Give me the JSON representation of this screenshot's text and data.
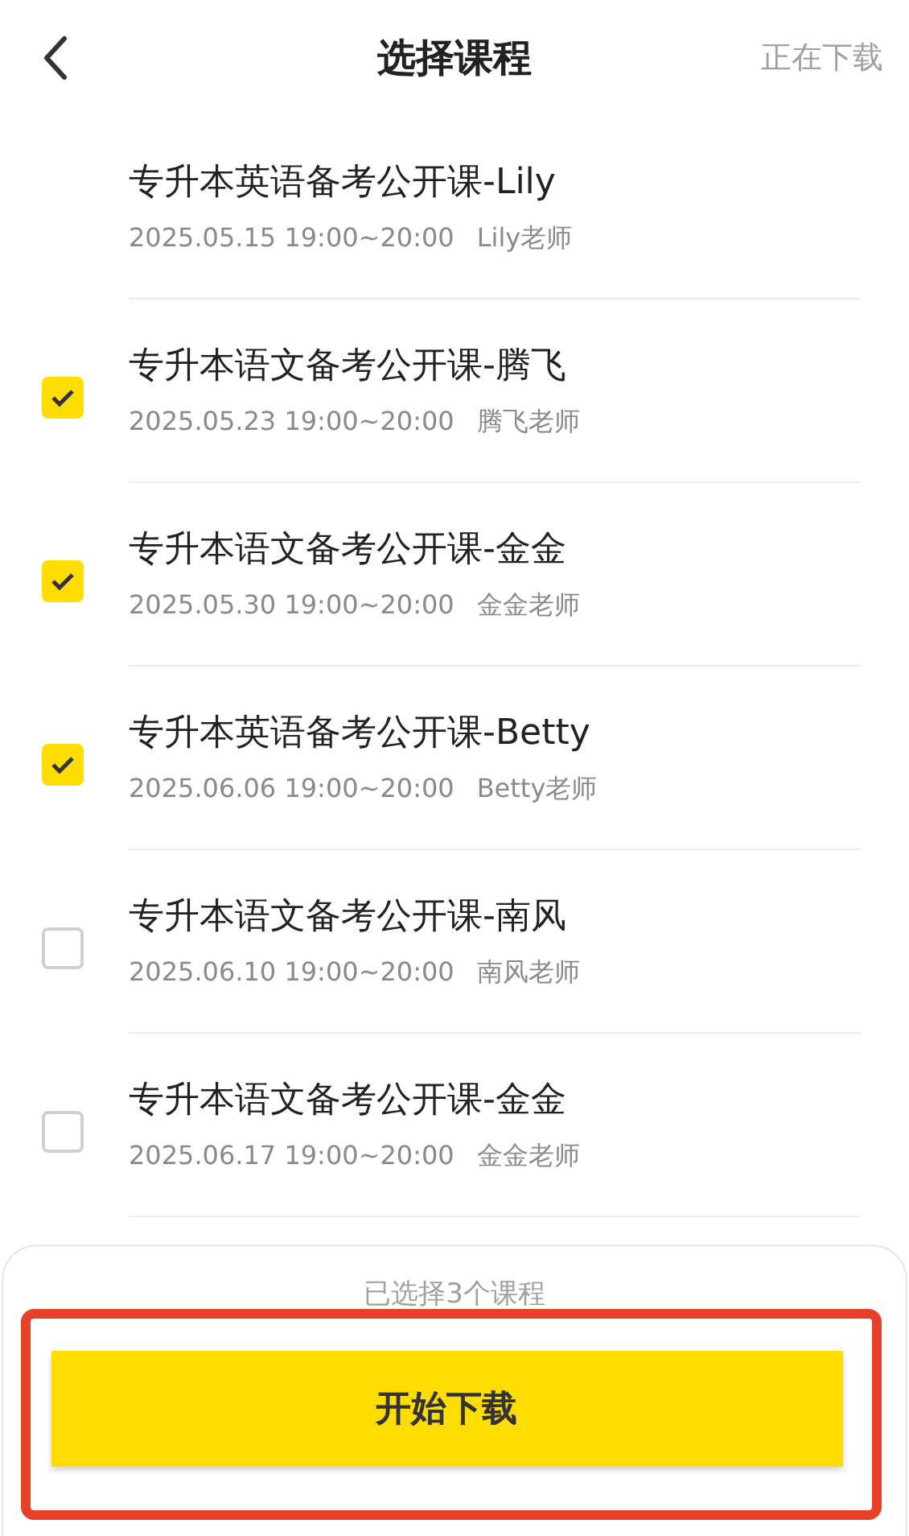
{
  "header": {
    "title": "选择课程",
    "action": "正在下载"
  },
  "courses": [
    {
      "kind": "plain",
      "title": "专升本英语备考公开课-Lily",
      "time": "2025.05.15 19:00~20:00",
      "teacher": "Lily老师"
    },
    {
      "kind": "checkbox",
      "checked": true,
      "title": "专升本语文备考公开课-腾飞",
      "time": "2025.05.23 19:00~20:00",
      "teacher": "腾飞老师"
    },
    {
      "kind": "checkbox",
      "checked": true,
      "title": "专升本语文备考公开课-金金",
      "time": "2025.05.30 19:00~20:00",
      "teacher": "金金老师"
    },
    {
      "kind": "checkbox",
      "checked": true,
      "title": "专升本英语备考公开课-Betty",
      "time": "2025.06.06 19:00~20:00",
      "teacher": "Betty老师"
    },
    {
      "kind": "checkbox",
      "checked": false,
      "title": "专升本语文备考公开课-南风",
      "time": "2025.06.10 19:00~20:00",
      "teacher": "南风老师"
    },
    {
      "kind": "checkbox",
      "checked": false,
      "title": "专升本语文备考公开课-金金",
      "time": "2025.06.17 19:00~20:00",
      "teacher": "金金老师"
    }
  ],
  "footer": {
    "selected_count": "已选择3个课程",
    "button": "开始下载"
  }
}
